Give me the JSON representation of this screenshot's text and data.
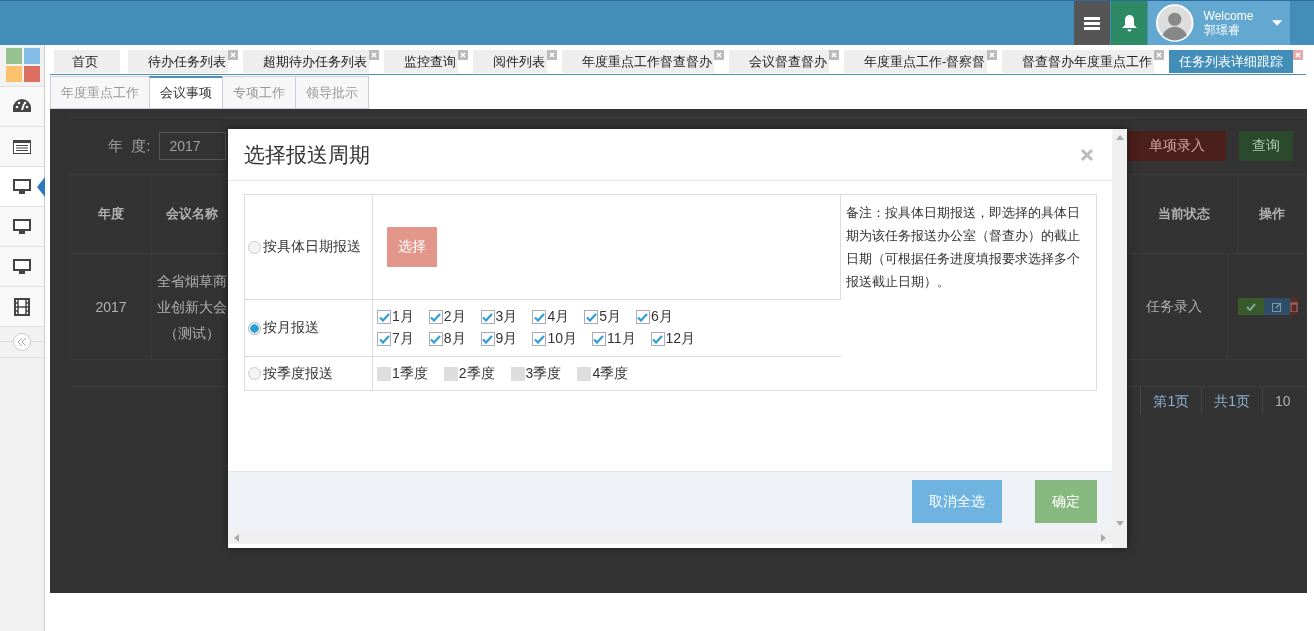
{
  "header": {
    "welcome": "Welcome",
    "user": "郭璟睿"
  },
  "sidebar": {
    "items": [
      {
        "kind": "gauge",
        "selected": false
      },
      {
        "kind": "list",
        "selected": false
      },
      {
        "kind": "monitor",
        "selected": true
      },
      {
        "kind": "monitor",
        "selected": false
      },
      {
        "kind": "monitor",
        "selected": false
      },
      {
        "kind": "film",
        "selected": false
      }
    ]
  },
  "tabs": [
    {
      "label": "首页",
      "closable": false,
      "selected": false
    },
    {
      "label": "待办任务列表",
      "closable": true,
      "selected": false
    },
    {
      "label": "超期待办任务列表",
      "closable": true,
      "selected": false
    },
    {
      "label": "监控查询",
      "closable": true,
      "selected": false
    },
    {
      "label": "阅件列表",
      "closable": true,
      "selected": false
    },
    {
      "label": "年度重点工作督查督办",
      "closable": true,
      "selected": false
    },
    {
      "label": "会议督查督办",
      "closable": true,
      "selected": false
    },
    {
      "label": "年度重点工作-督察督",
      "closable": true,
      "selected": false
    },
    {
      "label": "督查督办年度重点工作",
      "closable": true,
      "selected": false
    },
    {
      "label": "任务列表详细跟踪",
      "closable": true,
      "selected": true
    }
  ],
  "subtabs": [
    {
      "label": "年度重点工作",
      "selected": false
    },
    {
      "label": "会议事项",
      "selected": true
    },
    {
      "label": "专项工作",
      "selected": false
    },
    {
      "label": "领导批示",
      "selected": false
    }
  ],
  "filter": {
    "year_label": "年  度:",
    "year_value": "2017",
    "buttons": [
      {
        "label": "单项录入",
        "kind": "danger"
      },
      {
        "label": "查询",
        "kind": "success"
      }
    ]
  },
  "table": {
    "columns": [
      "年度",
      "会议名称",
      "当前状态",
      "操作"
    ],
    "rows": [
      {
        "year": "2017",
        "name": "全省烟草商业创新大会（测试）",
        "status": "任务录入"
      }
    ]
  },
  "pagination": [
    "第1页",
    "共1页",
    "10"
  ],
  "modal": {
    "title": "选择报送周期",
    "options": [
      {
        "kind": "date",
        "label": "按具体日期报送",
        "selected": false,
        "button": "选择"
      },
      {
        "kind": "month",
        "label": "按月报送",
        "selected": true,
        "items": [
          {
            "label": "1月",
            "checked": true
          },
          {
            "label": "2月",
            "checked": true
          },
          {
            "label": "3月",
            "checked": true
          },
          {
            "label": "4月",
            "checked": true
          },
          {
            "label": "5月",
            "checked": true
          },
          {
            "label": "6月",
            "checked": true
          },
          {
            "label": "7月",
            "checked": true
          },
          {
            "label": "8月",
            "checked": true
          },
          {
            "label": "9月",
            "checked": true
          },
          {
            "label": "10月",
            "checked": true
          },
          {
            "label": "11月",
            "checked": true
          },
          {
            "label": "12月",
            "checked": true
          }
        ]
      },
      {
        "kind": "quarter",
        "label": "按季度报送",
        "selected": false,
        "items": [
          {
            "label": "1季度",
            "checked": false
          },
          {
            "label": "2季度",
            "checked": false
          },
          {
            "label": "3季度",
            "checked": false
          },
          {
            "label": "4季度",
            "checked": false
          }
        ]
      }
    ],
    "note": "备注：按具体日期报送，即选择的具体日期为该任务报送办公室（督查办）的截止日期（可根据任务进度填报要求选择多个报送截止日期）。",
    "buttons": [
      {
        "label": "取消全选",
        "kind": "secondary"
      },
      {
        "label": "确定",
        "kind": "primary"
      }
    ]
  }
}
